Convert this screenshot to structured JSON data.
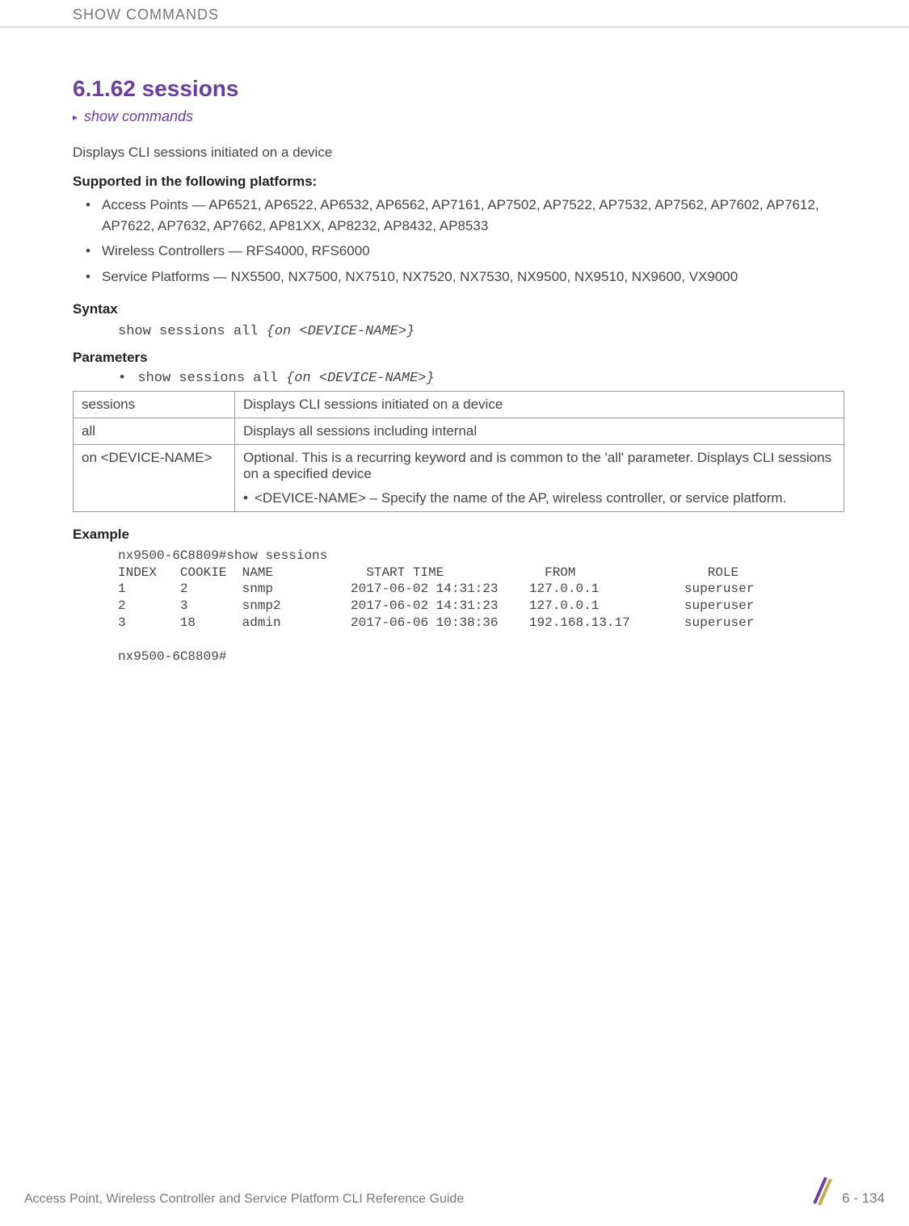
{
  "header": {
    "title": "SHOW COMMANDS"
  },
  "section": {
    "number_title": "6.1.62 sessions",
    "breadcrumb": "show commands",
    "description": "Displays CLI sessions initiated on a device",
    "supported_heading": "Supported in the following platforms:",
    "supported_items": [
      "Access Points — AP6521, AP6522, AP6532, AP6562, AP7161, AP7502, AP7522, AP7532, AP7562, AP7602, AP7612, AP7622, AP7632, AP7662, AP81XX, AP8232, AP8432, AP8533",
      "Wireless Controllers — RFS4000, RFS6000",
      "Service Platforms — NX5500, NX7500, NX7510, NX7520, NX7530, NX9500, NX9510, NX9600, VX9000"
    ],
    "syntax_heading": "Syntax",
    "syntax_cmd_plain": "show sessions all ",
    "syntax_cmd_italic": "{on <DEVICE-NAME>}",
    "parameters_heading": "Parameters",
    "param_line_bullet": "•",
    "param_line_plain": " show sessions all ",
    "param_line_italic": "{on <DEVICE-NAME>}",
    "param_table": [
      {
        "name": "sessions",
        "desc": "Displays CLI sessions initiated on a device"
      },
      {
        "name": "all",
        "desc": "Displays all sessions including internal"
      },
      {
        "name": "on <DEVICE-NAME>",
        "desc": "Optional. This is a recurring keyword and is common to the 'all' parameter. Displays CLI sessions on a specified device",
        "sub": "<DEVICE-NAME> – Specify the name of the AP, wireless controller, or service platform."
      }
    ],
    "example_heading": "Example",
    "example_text": "nx9500-6C8809#show sessions\nINDEX   COOKIE  NAME            START TIME             FROM                 ROLE\n1       2       snmp          2017-06-02 14:31:23    127.0.0.1           superuser\n2       3       snmp2         2017-06-02 14:31:23    127.0.0.1           superuser\n3       18      admin         2017-06-06 10:38:36    192.168.13.17       superuser\n\nnx9500-6C8809#"
  },
  "footer": {
    "guide": "Access Point, Wireless Controller and Service Platform CLI Reference Guide",
    "page": "6 - 134"
  }
}
